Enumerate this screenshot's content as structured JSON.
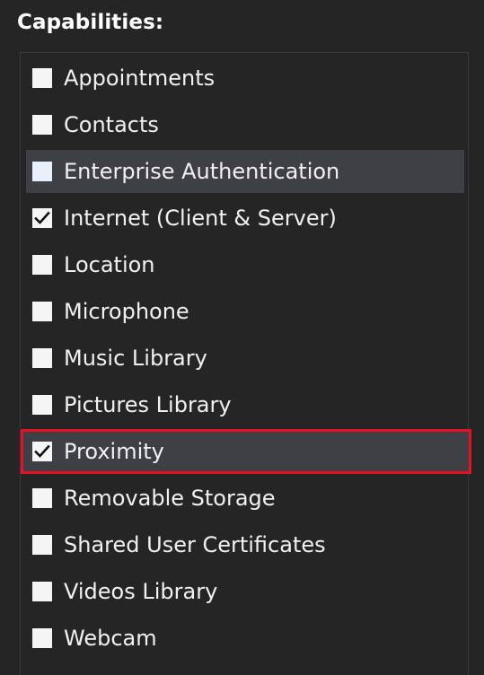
{
  "header": {
    "title": "Capabilities:"
  },
  "capabilities": [
    {
      "label": "Appointments",
      "checked": false
    },
    {
      "label": "Contacts",
      "checked": false
    },
    {
      "label": "Enterprise Authentication",
      "checked": false,
      "state": "hover"
    },
    {
      "label": "Internet (Client & Server)",
      "checked": true
    },
    {
      "label": "Location",
      "checked": false
    },
    {
      "label": "Microphone",
      "checked": false
    },
    {
      "label": "Music Library",
      "checked": false
    },
    {
      "label": "Pictures Library",
      "checked": false
    },
    {
      "label": "Proximity",
      "checked": true,
      "state": "highlighted"
    },
    {
      "label": "Removable Storage",
      "checked": false
    },
    {
      "label": "Shared User Certificates",
      "checked": false
    },
    {
      "label": "Videos Library",
      "checked": false
    },
    {
      "label": "Webcam",
      "checked": false
    }
  ],
  "colors": {
    "background": "#252526",
    "highlight_border": "#e81123",
    "row_hover": "#3f3f46"
  }
}
